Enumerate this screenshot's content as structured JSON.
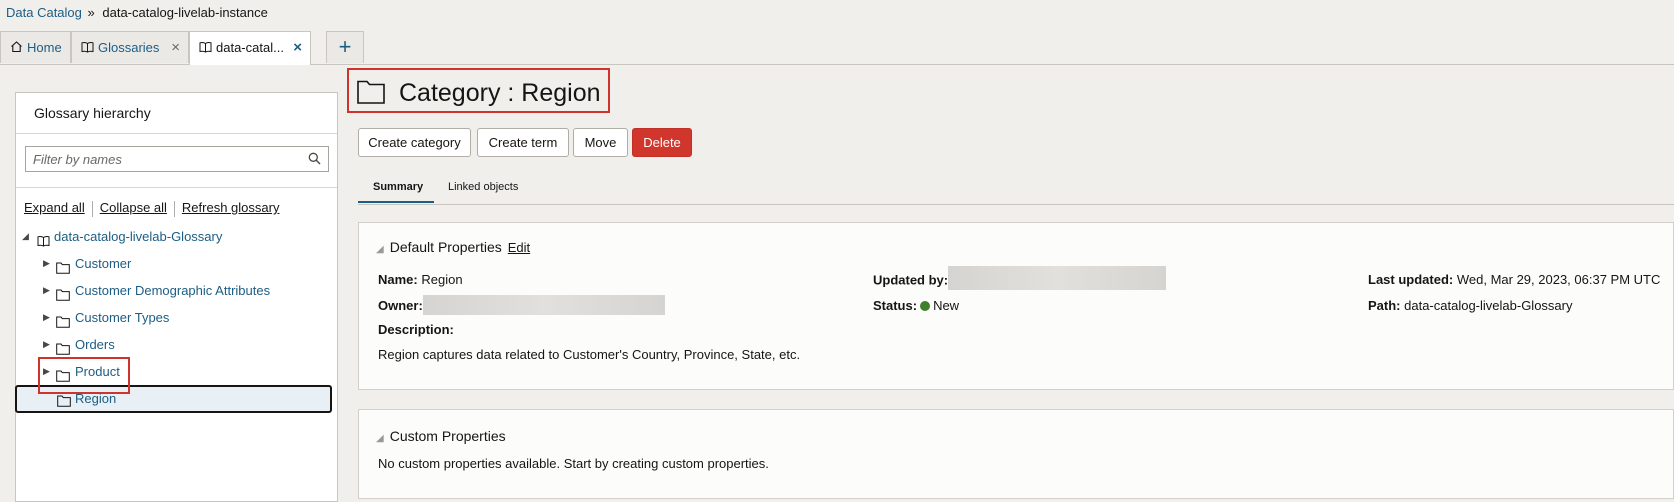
{
  "breadcrumb": {
    "root": "Data Catalog",
    "separator": "»",
    "current": "data-catalog-livelab-instance"
  },
  "tabs": [
    {
      "label": "Home",
      "icon": "home-icon"
    },
    {
      "label": "Glossaries",
      "icon": "book-icon",
      "close": "×"
    },
    {
      "label": "data-catal...",
      "icon": "book-icon",
      "close": "×"
    }
  ],
  "add_tab": "+",
  "left_panel": {
    "title": "Glossary hierarchy",
    "filter_placeholder": "Filter by names",
    "actions": [
      "Expand all",
      "Collapse all",
      "Refresh glossary"
    ],
    "tree": {
      "glossary": "data-catalog-livelab-Glossary",
      "items": [
        "Customer",
        "Customer Demographic Attributes",
        "Customer Types",
        "Orders",
        "Product",
        "Region"
      ],
      "selected": "Region"
    }
  },
  "main": {
    "title": "Category : Region",
    "buttons": {
      "create_category": "Create category",
      "create_term": "Create term",
      "move": "Move",
      "delete": "Delete"
    },
    "subtabs": [
      "Summary",
      "Linked objects"
    ],
    "default_properties": {
      "heading": "Default Properties",
      "edit": "Edit",
      "name_label": "Name:",
      "name_value": "Region",
      "owner_label": "Owner:",
      "description_label": "Description:",
      "description_value": "Region captures data related to Customer's Country, Province, State, etc.",
      "updated_by_label": "Updated by:",
      "status_label": "Status:",
      "status_value": "New",
      "last_updated_label": "Last updated:",
      "last_updated_value": "Wed, Mar 29, 2023, 06:37 PM UTC",
      "path_label": "Path:",
      "path_value": "data-catalog-livelab-Glossary"
    },
    "custom_properties": {
      "heading": "Custom Properties",
      "message": "No custom properties available. Start by creating custom properties."
    }
  },
  "colors": {
    "link": "#1d5d84",
    "danger": "#d1362c",
    "status_new": "#3f7f2e",
    "highlight": "#d0322c"
  }
}
